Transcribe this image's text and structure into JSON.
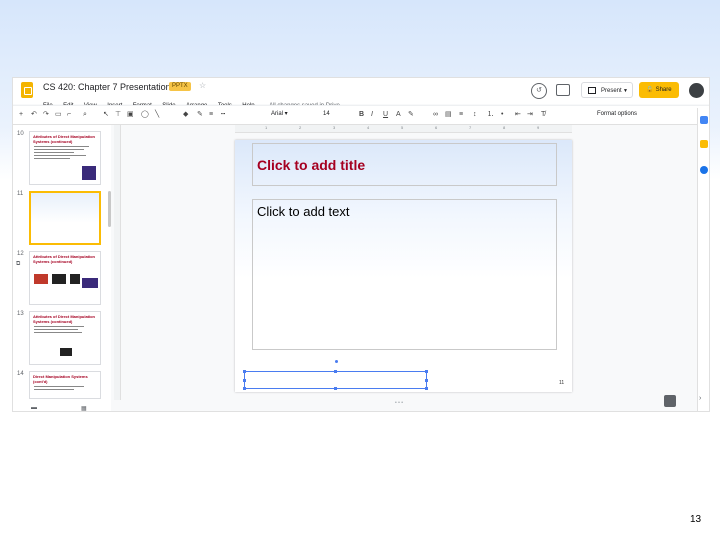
{
  "app": {
    "doc_title": "CS 420: Chapter 7 Presentation",
    "badge": "PPTX",
    "menu": [
      "File",
      "Edit",
      "View",
      "Insert",
      "Format",
      "Slide",
      "Arrange",
      "Tools",
      "Help"
    ],
    "save_status": "All changes saved in Drive",
    "present_label": "Present",
    "share_label": "Share"
  },
  "toolbar": {
    "font": "Arial",
    "font_size": "14",
    "format_options": "Format options"
  },
  "ruler": {
    "ticks": [
      "1",
      "2",
      "3",
      "4",
      "5",
      "6",
      "7",
      "8",
      "9"
    ]
  },
  "thumbnails": [
    {
      "num": "10",
      "title": "Attributes of Direct Manipulation Systems (continued)"
    },
    {
      "num": "11",
      "title": ""
    },
    {
      "num": "12",
      "title": "Attributes of Direct Manipulation Systems (continued)"
    },
    {
      "num": "13",
      "title": "Attributes of Direct Manipulation Systems (continued)"
    },
    {
      "num": "14",
      "title": "Direct Manipulation Systems (cont'd)"
    }
  ],
  "slide": {
    "title_placeholder": "Click to add title",
    "body_placeholder": "Click to add text",
    "number": "11"
  },
  "page_number": "13",
  "colors": {
    "accent": "#fbbc04",
    "title_text": "#a50021",
    "selection": "#4a7cf0"
  }
}
